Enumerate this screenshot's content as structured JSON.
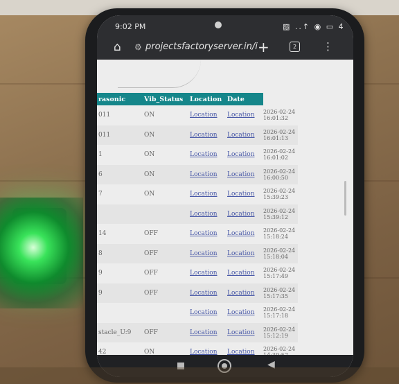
{
  "status_bar": {
    "time": "9:02 PM",
    "indicators": "▨ ..↑ ◉ ▭ 4"
  },
  "browser": {
    "url": "projectsfactoryserver.in/i",
    "home_icon": "home-icon",
    "tabs_count": "2",
    "new_tab_label": "+",
    "menu_label": "⋮"
  },
  "table": {
    "headers": [
      "rasonic",
      "Vib_Status",
      "Location",
      "Date",
      ""
    ],
    "rows": [
      {
        "c1": "011",
        "vib": "ON",
        "loc": "Location",
        "date": "Location",
        "ts": "2026-02-24 16:01:32"
      },
      {
        "c1": "011",
        "vib": "ON",
        "loc": "Location",
        "date": "Location",
        "ts": "2026-02-24 16:01:13"
      },
      {
        "c1": "1",
        "vib": "ON",
        "loc": "Location",
        "date": "Location",
        "ts": "2026-02-24 16:01:02"
      },
      {
        "c1": "6",
        "vib": "ON",
        "loc": "Location",
        "date": "Location",
        "ts": "2026-02-24 16:00:50"
      },
      {
        "c1": "7",
        "vib": "ON",
        "loc": "Location",
        "date": "Location",
        "ts": "2026-02-24 15:39:23"
      },
      {
        "c1": "",
        "vib": "",
        "loc": "Location",
        "date": "Location",
        "ts": "2026-02-24 15:39:12"
      },
      {
        "c1": "14",
        "vib": "OFF",
        "loc": "Location",
        "date": "Location",
        "ts": "2026-02-24 15:18:24"
      },
      {
        "c1": "8",
        "vib": "OFF",
        "loc": "Location",
        "date": "Location",
        "ts": "2026-02-24 15:18:04"
      },
      {
        "c1": "9",
        "vib": "OFF",
        "loc": "Location",
        "date": "Location",
        "ts": "2026-02-24 15:17:49"
      },
      {
        "c1": "9",
        "vib": "OFF",
        "loc": "Location",
        "date": "Location",
        "ts": "2026-02-24 15:17:35"
      },
      {
        "c1": "",
        "vib": "",
        "loc": "Location",
        "date": "Location",
        "ts": "2026-02-24 15:17:18"
      },
      {
        "c1": "stacle_U:9",
        "vib": "OFF",
        "loc": "Location",
        "date": "Location",
        "ts": "2026-02-24 15:12:19"
      },
      {
        "c1": "42",
        "vib": "ON",
        "loc": "Location",
        "date": "Location",
        "ts": "2026-02-24 14:39:57"
      }
    ]
  },
  "nav": {
    "back_glyph": "◀"
  },
  "colors": {
    "header_bg": "#15868a",
    "link": "#4a5aa8",
    "browser_chrome": "#2d2e31"
  }
}
